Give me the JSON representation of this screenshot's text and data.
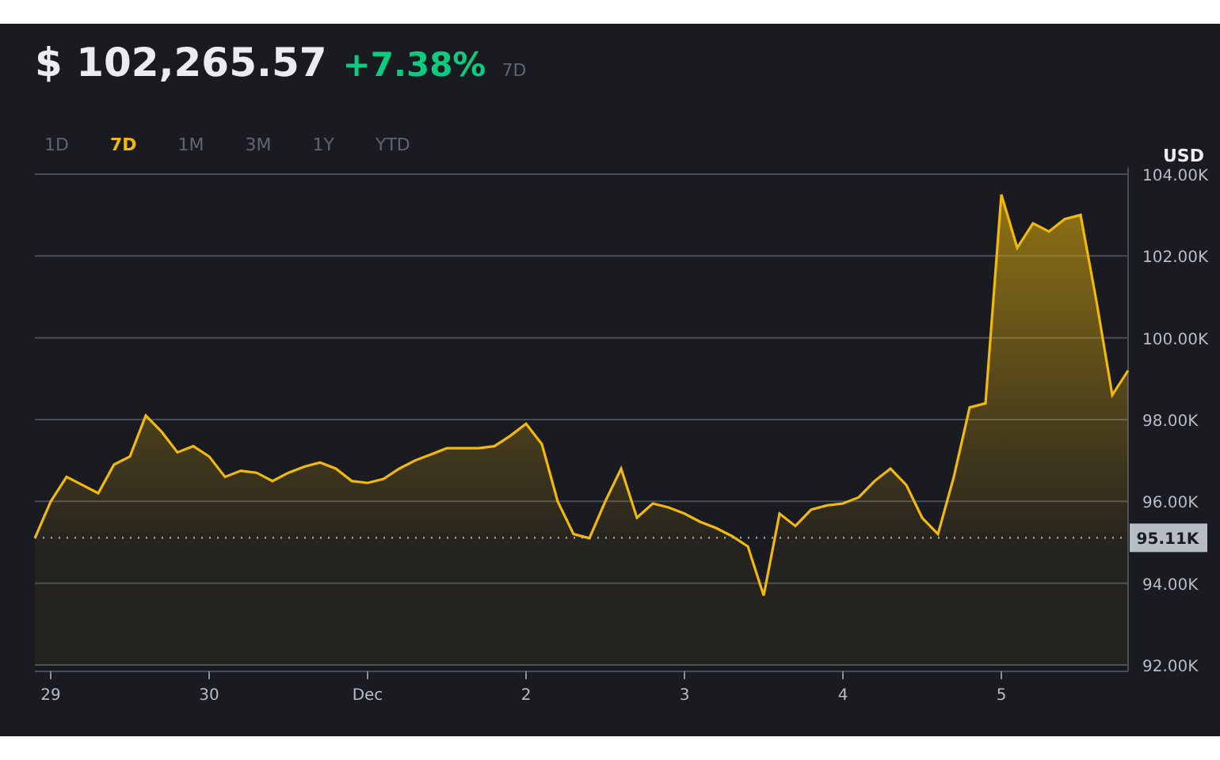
{
  "header": {
    "price": "$ 102,265.57",
    "change": "+7.38%",
    "period": "7D"
  },
  "range_tabs": [
    {
      "label": "1D",
      "selected": false
    },
    {
      "label": "7D",
      "selected": true
    },
    {
      "label": "1M",
      "selected": false
    },
    {
      "label": "3M",
      "selected": false
    },
    {
      "label": "1Y",
      "selected": false
    },
    {
      "label": "YTD",
      "selected": false
    }
  ],
  "chart": {
    "chart_data": {
      "type": "area",
      "ylabel": "USD",
      "categories": [
        null,
        "29",
        null,
        null,
        null,
        null,
        null,
        null,
        null,
        null,
        null,
        "30",
        null,
        null,
        null,
        null,
        null,
        null,
        null,
        null,
        null,
        "Dec",
        null,
        null,
        null,
        null,
        null,
        null,
        null,
        null,
        null,
        "2",
        null,
        null,
        null,
        null,
        null,
        null,
        null,
        null,
        null,
        "3",
        null,
        null,
        null,
        null,
        null,
        null,
        null,
        null,
        null,
        "4",
        null,
        null,
        null,
        null,
        null,
        null,
        null,
        null,
        null,
        "5",
        null,
        null,
        null,
        null,
        null,
        null,
        null,
        null
      ],
      "series": [
        {
          "color": "#f0b90b",
          "values": [
            95.1,
            96.0,
            96.6,
            96.4,
            96.2,
            96.9,
            97.1,
            98.1,
            97.7,
            97.2,
            97.35,
            97.1,
            96.6,
            96.75,
            96.7,
            96.5,
            96.7,
            96.85,
            96.95,
            96.8,
            96.5,
            96.45,
            96.55,
            96.8,
            97.0,
            97.15,
            97.3,
            97.3,
            97.3,
            97.35,
            97.6,
            97.9,
            97.4,
            96.0,
            95.2,
            95.1,
            96.0,
            96.8,
            95.6,
            95.95,
            95.85,
            95.7,
            95.5,
            95.35,
            95.15,
            94.9,
            93.7,
            95.7,
            95.4,
            95.8,
            95.9,
            95.95,
            96.1,
            96.5,
            96.8,
            96.4,
            95.6,
            95.2,
            96.6,
            98.3,
            98.4,
            103.5,
            102.2,
            102.8,
            102.6,
            102.9,
            103.0,
            100.9,
            98.6,
            99.2
          ]
        }
      ],
      "ylim": [
        92,
        104
      ],
      "yticks": [
        {
          "value": 92,
          "label": "92.00K"
        },
        {
          "value": 94,
          "label": "94.00K"
        },
        {
          "value": 96,
          "label": "96.00K"
        },
        {
          "value": 98,
          "label": "98.00K"
        },
        {
          "value": 100,
          "label": "100.00K"
        },
        {
          "value": 102,
          "label": "102.00K"
        },
        {
          "value": 104,
          "label": "104.00K"
        }
      ],
      "grid": true,
      "ref_lines": [
        {
          "axis": "y",
          "value": 95.11,
          "label": "95.11K"
        }
      ]
    }
  }
}
